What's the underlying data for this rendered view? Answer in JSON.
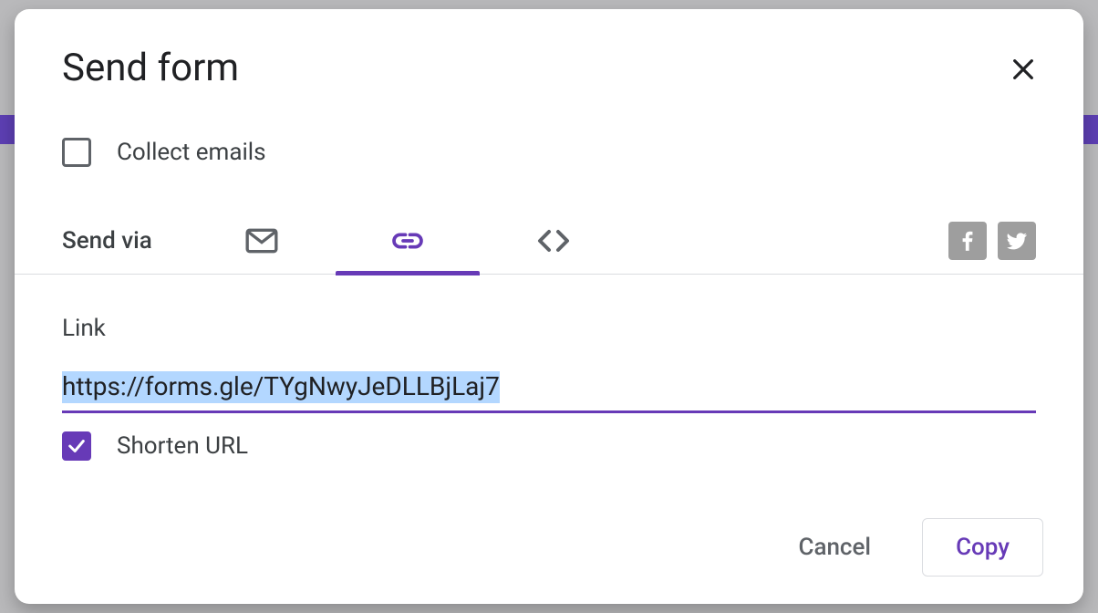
{
  "dialog": {
    "title": "Send form",
    "collectEmailsLabel": "Collect emails",
    "collectEmailsChecked": false,
    "sendViaLabel": "Send via",
    "tabs": {
      "email": {
        "active": false
      },
      "link": {
        "active": true
      },
      "embed": {
        "active": false
      }
    },
    "linkSection": {
      "heading": "Link",
      "url": "https://forms.gle/TYgNwyJeDLLBjLaj7",
      "shortenLabel": "Shorten URL",
      "shortenChecked": true
    },
    "actions": {
      "cancel": "Cancel",
      "copy": "Copy"
    },
    "colors": {
      "accent": "#673ab7"
    }
  }
}
